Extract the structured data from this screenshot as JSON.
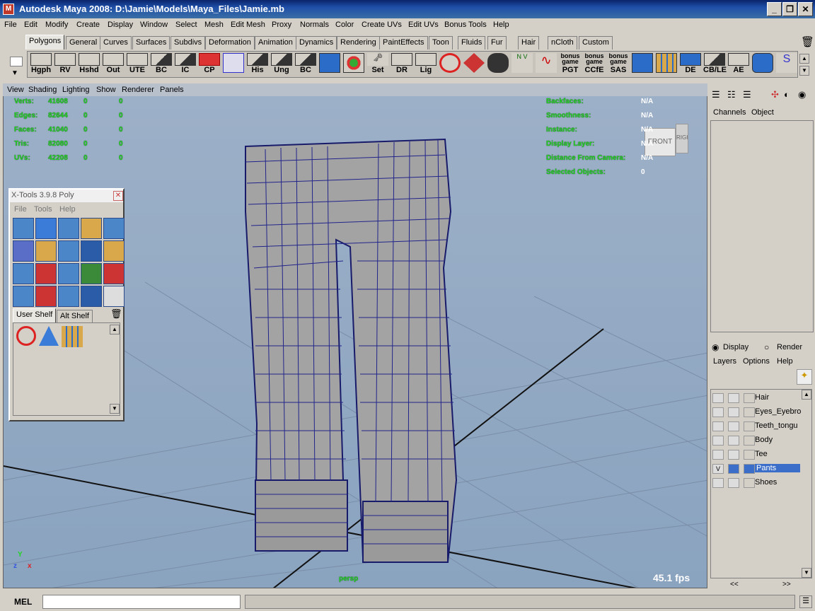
{
  "window": {
    "title": "Autodesk Maya 2008: D:\\Jamie\\Models\\Maya_Files\\Jamie.mb",
    "minimize": "_",
    "maximize": "❐",
    "close": "✕"
  },
  "menu": [
    "File",
    "Edit",
    "Modify",
    "Create",
    "Display",
    "Window",
    "Select",
    "Mesh",
    "Edit Mesh",
    "Proxy",
    "Normals",
    "Color",
    "Create UVs",
    "Edit UVs",
    "Bonus Tools",
    "Help"
  ],
  "shelf_tabs": [
    "Polygons",
    "General",
    "Curves",
    "Surfaces",
    "Subdivs",
    "Deformation",
    "Animation",
    "Dynamics",
    "Rendering",
    "PaintEffects",
    "Toon",
    "Fluids",
    "Fur",
    "Hair",
    "nCloth",
    "Custom"
  ],
  "shelf_icons": [
    "Hgph",
    "RV",
    "Hshd",
    "Out",
    "UTE",
    "BC",
    "IC",
    "CP",
    "",
    "His",
    "Ung",
    "BC",
    "",
    "",
    "Set",
    "DR",
    "Lig",
    "",
    "",
    "",
    "",
    "",
    "bonus game PGT",
    "bonus game CCfE",
    "bonus game SAS",
    "",
    "",
    "DE",
    "CB/LE",
    "AE",
    "",
    ""
  ],
  "viewport_menu": [
    "View",
    "Shading",
    "Lighting",
    "Show",
    "Renderer",
    "Panels"
  ],
  "hud_left": [
    {
      "label": "Verts:",
      "a": "41608",
      "b": "0",
      "c": "0"
    },
    {
      "label": "Edges:",
      "a": "82644",
      "b": "0",
      "c": "0"
    },
    {
      "label": "Faces:",
      "a": "41040",
      "b": "0",
      "c": "0"
    },
    {
      "label": "Tris:",
      "a": "82080",
      "b": "0",
      "c": "0"
    },
    {
      "label": "UVs:",
      "a": "42208",
      "b": "0",
      "c": "0"
    }
  ],
  "hud_right": [
    {
      "label": "Backfaces:",
      "value": "N/A"
    },
    {
      "label": "Smoothness:",
      "value": "N/A"
    },
    {
      "label": "Instance:",
      "value": "N/A"
    },
    {
      "label": "Display Layer:",
      "value": "N/A"
    },
    {
      "label": "Distance From Camera:",
      "value": "N/A"
    },
    {
      "label": "Selected Objects:",
      "value": "0"
    }
  ],
  "viewcube": {
    "front": "FRONT",
    "side": "RIGHT"
  },
  "fps": "45.1 fps",
  "camera_label": "persp",
  "axis": {
    "y": "Y",
    "z": "z",
    "x": "x"
  },
  "xtools": {
    "title": "X-Tools 3.9.8 Poly",
    "menu": [
      "File",
      "Tools",
      "Help"
    ],
    "tabs": [
      "User Shelf",
      "Alt Shelf"
    ]
  },
  "channel_tabs": [
    "Channels",
    "Object"
  ],
  "layer_mode": {
    "display": "Display",
    "render": "Render"
  },
  "layer_menu": [
    "Layers",
    "Options",
    "Help"
  ],
  "layers": [
    {
      "name": "Hair",
      "v": ""
    },
    {
      "name": "Eyes_Eyebro",
      "v": ""
    },
    {
      "name": "Teeth_tongu",
      "v": ""
    },
    {
      "name": "Body",
      "v": ""
    },
    {
      "name": "Tee",
      "v": ""
    },
    {
      "name": "Pants",
      "v": "V"
    },
    {
      "name": "Shoes",
      "v": ""
    }
  ],
  "layer_nav": {
    "prev": "<<",
    "next": ">>"
  },
  "command": {
    "label": "MEL",
    "value": ""
  }
}
